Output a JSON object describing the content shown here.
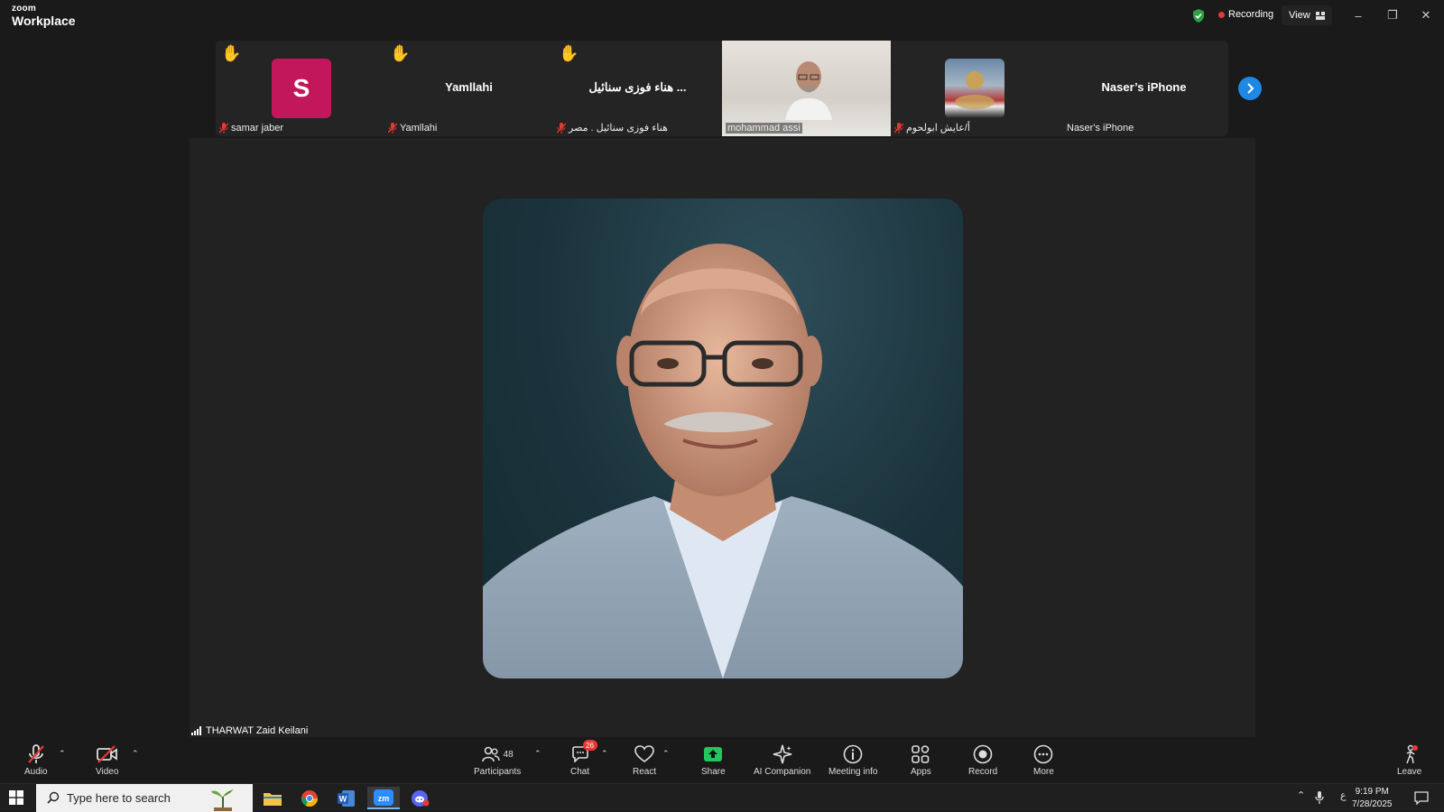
{
  "titlebar": {
    "brand_small": "zoom",
    "brand_big": "Workplace",
    "recording_label": "Recording",
    "view_label": "View",
    "minimize": "–",
    "restore": "❐",
    "close": "✕"
  },
  "participants_strip": {
    "tiles": [
      {
        "name": "samar jaber",
        "avatar_letter": "S",
        "hand_raised": true,
        "muted": true
      },
      {
        "name": "Yamllahi",
        "display_name": "Yamllahi",
        "hand_raised": true,
        "muted": true
      },
      {
        "name": "هناء فوزى سنائيل . مصر",
        "display_name": "هناء فوزى سنائيل ...",
        "hand_raised": true,
        "muted": true
      },
      {
        "name": "mohammad assi",
        "video": true,
        "muted": false
      },
      {
        "name": "أ/عايش ابولحوم",
        "thumbnail": true,
        "muted": true
      },
      {
        "name": "Naser's iPhone",
        "display_name": "Naser’s iPhone",
        "muted": false
      }
    ]
  },
  "stage": {
    "speaker_name": "THARWAT Zaid Keilani"
  },
  "toolbar": {
    "audio": "Audio",
    "video": "Video",
    "participants": "Participants",
    "participants_count": "48",
    "chat": "Chat",
    "chat_badge": "26",
    "react": "React",
    "share": "Share",
    "ai_companion": "AI Companion",
    "meeting_info": "Meeting info",
    "apps": "Apps",
    "record": "Record",
    "more": "More",
    "leave": "Leave"
  },
  "taskbar": {
    "search_placeholder": "Type here to search",
    "lang": "ع",
    "time": "9:19 PM",
    "date": "7/28/2025"
  },
  "colors": {
    "accent_blue": "#1e88e5",
    "share_green": "#22c55e",
    "record_red": "#e53935",
    "avatar_pink": "#c2185b"
  }
}
